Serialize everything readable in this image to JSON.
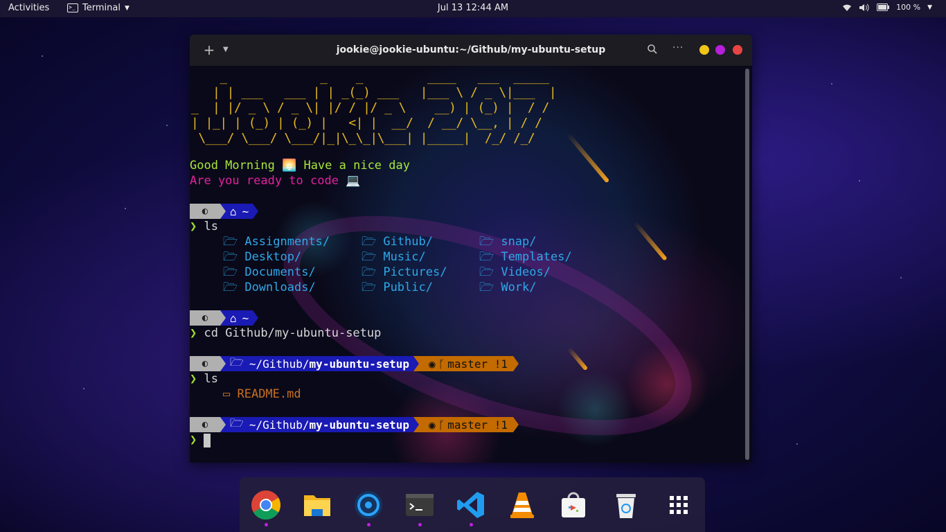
{
  "topbar": {
    "activities": "Activities",
    "app_name": "Terminal",
    "clock": "Jul 13  12:44 AM",
    "battery": "100 %"
  },
  "window": {
    "title": "jookie@jookie-ubuntu:~/Github/my-ubuntu-setup"
  },
  "terminal": {
    "ascii_art": "    _             _    _         ____   ___  _____\n   | | ___   ___ | | _(_) ___   |___ \\ / _ \\|___  |\n_  | |/ _ \\ / _ \\| |/ / |/ _ \\    __) | (_) |  / /\n| |_| | (_) | (_) |   <| |  __/  / __/ \\__, | / /\n \\___/ \\___/ \\___/|_|\\_\\_|\\___| |_____|  /_/ /_/",
    "greeting_1": "Good Morning 🌅 Have a nice day",
    "greeting_2": "Are you ready to code 💻",
    "home_symbol": "~",
    "git_branch": "master !1",
    "path_prefix": "~/Github/",
    "path_current": "my-ubuntu-setup",
    "chevron": "❯",
    "cmd_1": "ls",
    "cmd_2": "cd Github/my-ubuntu-setup",
    "cmd_3": "ls",
    "dirs": [
      [
        "Assignments/",
        "Github/",
        "snap/"
      ],
      [
        "Desktop/",
        "Music/",
        "Templates/"
      ],
      [
        "Documents/",
        "Pictures/",
        "Videos/"
      ],
      [
        "Downloads/",
        "Public/",
        "Work/"
      ]
    ],
    "file_1": "README.md"
  },
  "dock": {
    "items": [
      "chrome",
      "files",
      "pulse-browser",
      "terminal",
      "vscode",
      "vlc",
      "software-center",
      "trash",
      "show-applications"
    ]
  }
}
